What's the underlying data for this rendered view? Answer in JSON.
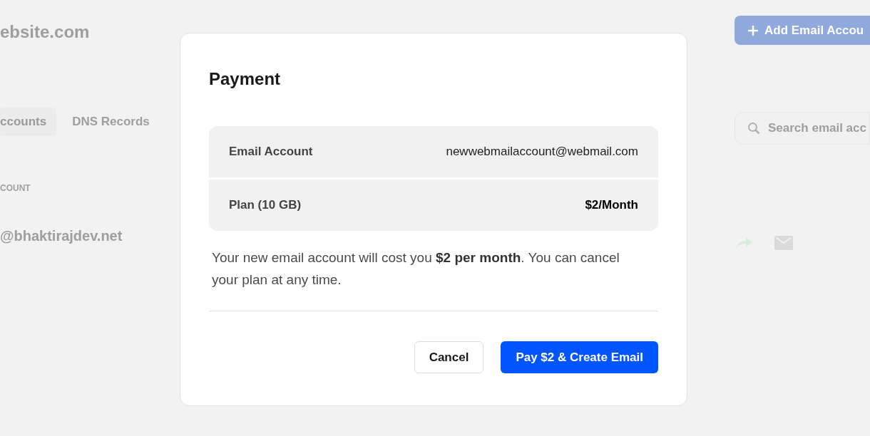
{
  "background": {
    "title": "ebsite.com",
    "add_button": "Add Email Accou",
    "tabs": [
      {
        "label": "ccounts",
        "selected": true
      },
      {
        "label": "DNS Records",
        "selected": false
      }
    ],
    "search": {
      "placeholder": "Search email acc"
    },
    "column_header": "COUNT",
    "rows": [
      {
        "email": "@bhaktirajdev.net"
      }
    ]
  },
  "dialog": {
    "title": "Payment",
    "summary": [
      {
        "label": "Email Account",
        "value": "newwebmailaccount@webmail.com",
        "emphasis": false
      },
      {
        "label": "Plan (10 GB)",
        "value": "$2/Month",
        "emphasis": true
      }
    ],
    "note": "Your new email account will cost you **$2 per month**. You can cancel your plan at any time.",
    "buttons": [
      {
        "label": "Cancel",
        "kind": "secondary"
      },
      {
        "label": "Pay $2 & Create Email",
        "kind": "primary"
      }
    ]
  }
}
